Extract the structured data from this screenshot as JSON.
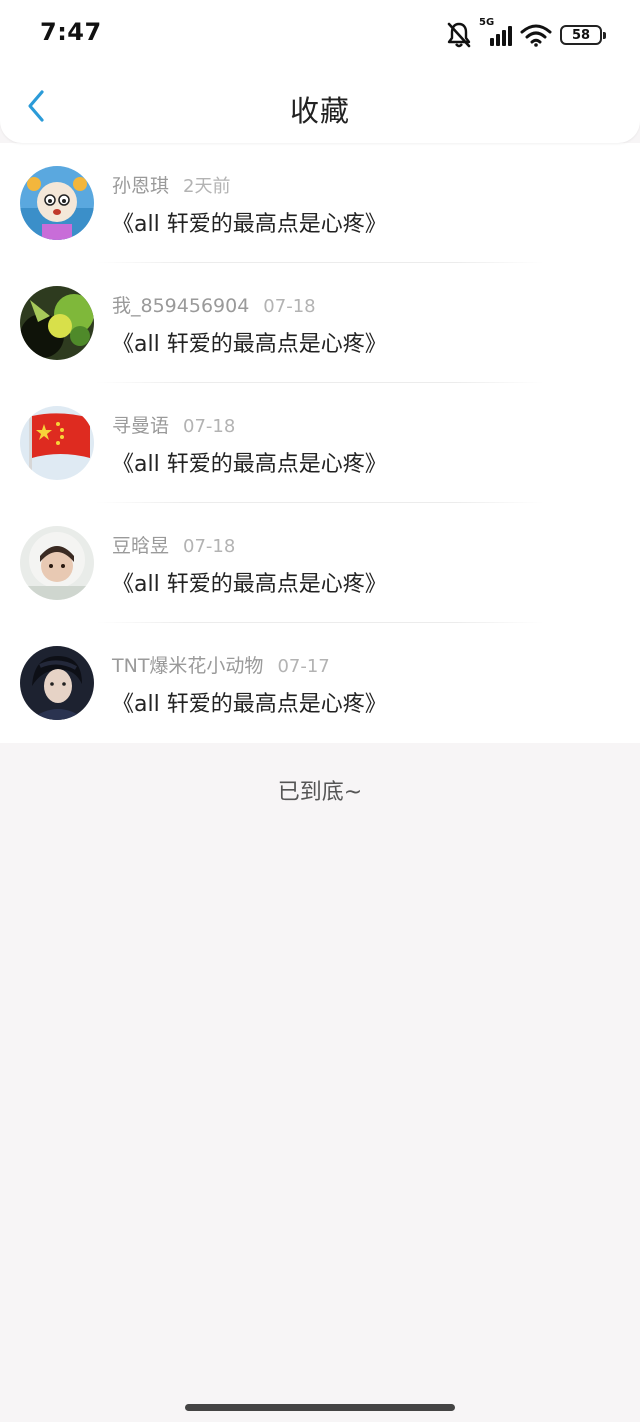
{
  "status": {
    "time": "7:47",
    "network": "5G",
    "battery": "58",
    "icons": [
      "bell-muted-icon",
      "signal-icon",
      "wifi-icon",
      "battery-icon"
    ]
  },
  "header": {
    "title": "收藏",
    "back_icon": "chevron-left-icon",
    "accent": "#2b9bd8"
  },
  "items": [
    {
      "user": "孙恩琪",
      "time": "2天前",
      "title": "《all 轩爱的最高点是心疼》"
    },
    {
      "user": "我_859456904",
      "time": "07-18",
      "title": "《all 轩爱的最高点是心疼》"
    },
    {
      "user": "寻曼语",
      "time": "07-18",
      "title": "《all 轩爱的最高点是心疼》"
    },
    {
      "user": "豆晗昱",
      "time": "07-18",
      "title": "《all 轩爱的最高点是心疼》"
    },
    {
      "user": "TNT爆米花小动物",
      "time": "07-17",
      "title": "《all 轩爱的最高点是心疼》"
    }
  ],
  "footer": {
    "end_text": "已到底~"
  }
}
